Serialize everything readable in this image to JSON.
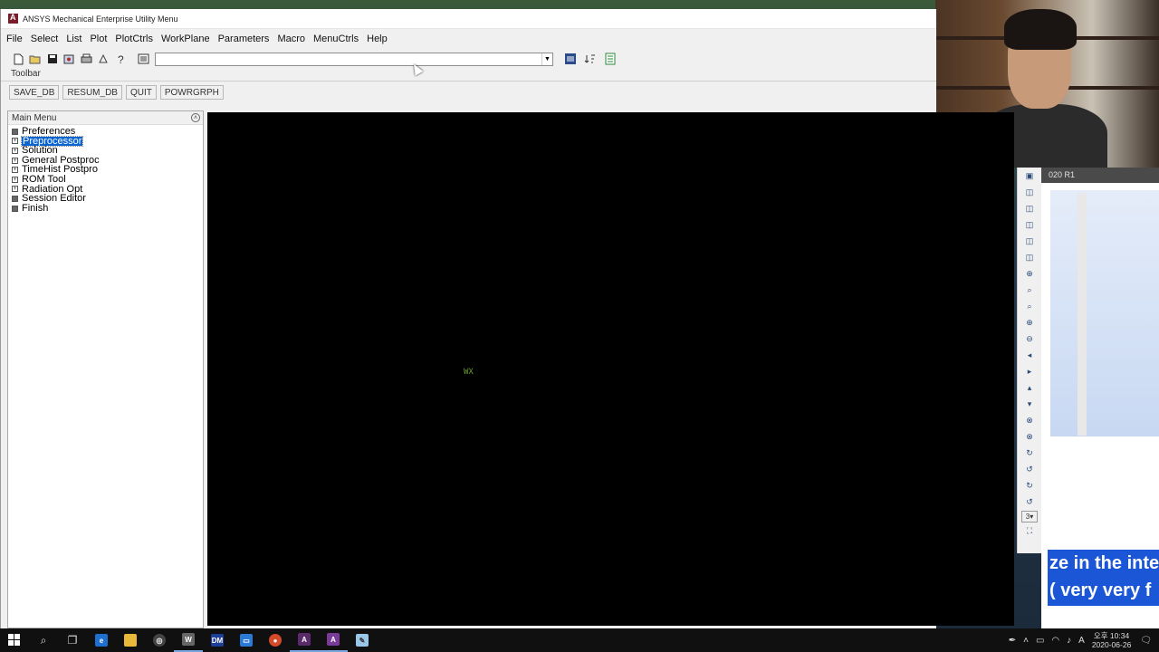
{
  "window": {
    "title": "ANSYS Mechanical Enterprise Utility Menu"
  },
  "menubar": [
    "File",
    "Select",
    "List",
    "Plot",
    "PlotCtrls",
    "WorkPlane",
    "Parameters",
    "Macro",
    "MenuCtrls",
    "Help"
  ],
  "command_input": {
    "value": ""
  },
  "toolbar": {
    "label": "Toolbar",
    "buttons": [
      "SAVE_DB",
      "RESUM_DB",
      "QUIT",
      "POWRGRPH"
    ]
  },
  "main_menu": {
    "title": "Main Menu",
    "items": [
      {
        "label": "Preferences",
        "selected": false
      },
      {
        "label": "Preprocessor",
        "selected": true
      },
      {
        "label": "Solution",
        "selected": false
      },
      {
        "label": "General Postproc",
        "selected": false
      },
      {
        "label": "TimeHist Postpro",
        "selected": false
      },
      {
        "label": "ROM Tool",
        "selected": false
      },
      {
        "label": "Radiation Opt",
        "selected": false
      },
      {
        "label": "Session Editor",
        "selected": false
      },
      {
        "label": "Finish",
        "selected": false
      }
    ]
  },
  "graphics": {
    "workplane_marker": "WX"
  },
  "background_window": {
    "title": "020 R1",
    "caption_line1": "ze in the inte",
    "caption_line2": "( very very f"
  },
  "taskbar": {
    "clock_time": "오후 10:34",
    "clock_date": "2020-06-26",
    "ime": "A"
  },
  "side_tools": {
    "dropdown_value": "3"
  },
  "colors": {
    "selection": "#0a64d2",
    "graphics_bg": "#000000",
    "caption_bg": "#1a56d6"
  }
}
